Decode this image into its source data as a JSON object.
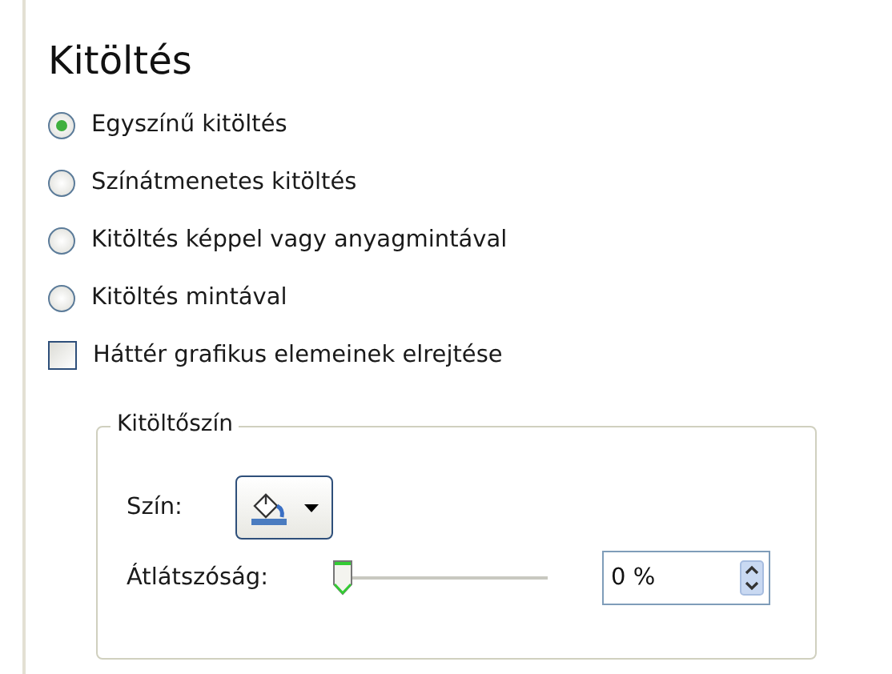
{
  "section": {
    "title": "Kitöltés"
  },
  "fill_options": [
    {
      "label": "Egyszínű kitöltés",
      "selected": true
    },
    {
      "label": "Színátmenetes kitöltés",
      "selected": false
    },
    {
      "label": "Kitöltés képpel vagy anyagmintával",
      "selected": false
    },
    {
      "label": "Kitöltés mintával",
      "selected": false
    }
  ],
  "hide_background": {
    "label": "Háttér grafikus elemeinek elrejtése",
    "checked": false
  },
  "fill_color": {
    "title": "Kitöltőszín",
    "color_label": "Szín:",
    "transparency_label": "Átlátszóság:",
    "transparency": {
      "level": 0,
      "value": "0 %"
    }
  }
}
